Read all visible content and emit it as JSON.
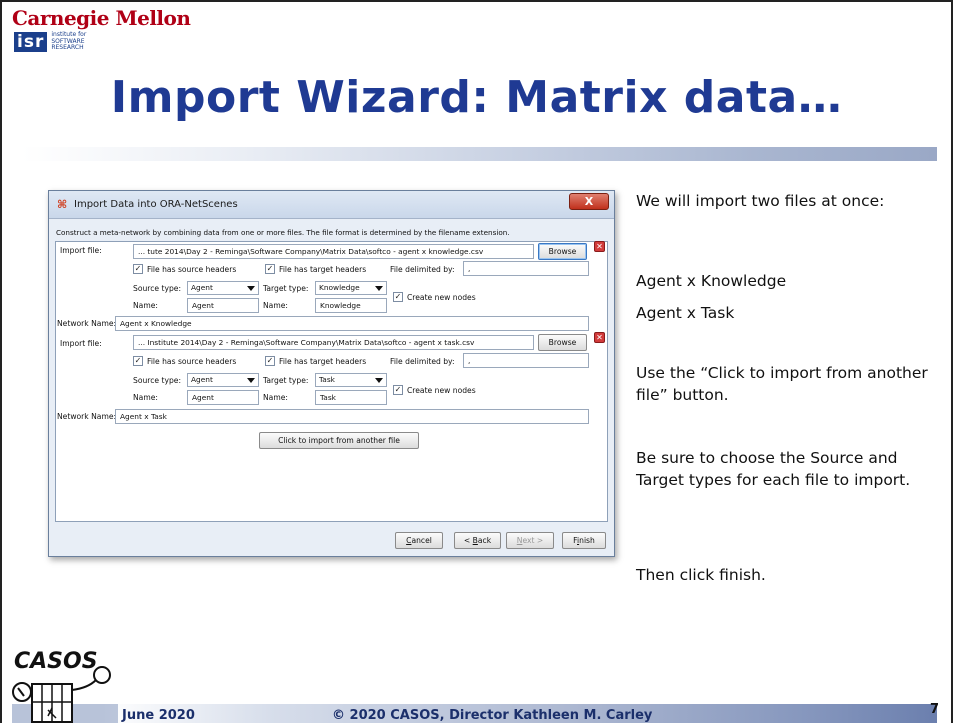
{
  "header": {
    "cmu_logo": "Carnegie Mellon",
    "isr_logo_mark": "isr",
    "isr_logo_text": [
      "institute for",
      "SOFTWARE",
      "RESEARCH"
    ]
  },
  "slide_title": "Import Wizard: Matrix data…",
  "dialog": {
    "title": "Import Data into ORA-NetScenes",
    "close_label": "X",
    "description": "Construct a meta-network by combining data from one or more files. The file format is determined by the filename extension.",
    "entries": [
      {
        "import_file_label": "Import file:",
        "import_file_value": "... tute 2014\\Day 2 - Reminga\\Software Company\\Matrix Data\\softco - agent x knowledge.csv",
        "browse_label": "Browse",
        "source_headers_label": "File has source headers",
        "target_headers_label": "File has target headers",
        "delimited_label": "File delimited by:",
        "delimiter_value": ",",
        "source_type_label": "Source type:",
        "source_type_value": "Agent",
        "target_type_label": "Target type:",
        "target_type_value": "Knowledge",
        "create_nodes_label": "Create new nodes",
        "source_name_label": "Name:",
        "source_name_value": "Agent",
        "target_name_label": "Name:",
        "target_name_value": "Knowledge",
        "network_name_label": "Network Name:",
        "network_name_value": "Agent x Knowledge"
      },
      {
        "import_file_label": "Import file:",
        "import_file_value": "... Institute 2014\\Day 2 - Reminga\\Software Company\\Matrix Data\\softco - agent x task.csv",
        "browse_label": "Browse",
        "source_headers_label": "File has source headers",
        "target_headers_label": "File has target headers",
        "delimited_label": "File delimited by:",
        "delimiter_value": ",",
        "source_type_label": "Source type:",
        "source_type_value": "Agent",
        "target_type_label": "Target type:",
        "target_type_value": "Task",
        "create_nodes_label": "Create new nodes",
        "source_name_label": "Name:",
        "source_name_value": "Agent",
        "target_name_label": "Name:",
        "target_name_value": "Task",
        "network_name_label": "Network Name:",
        "network_name_value": "Agent x Task"
      }
    ],
    "add_file_button": "Click to import from another file",
    "cancel_first": "C",
    "cancel_rest": "ancel",
    "back_prefix": "< ",
    "back_first": "B",
    "back_rest": "ack",
    "next_first": "N",
    "next_rest": "ext >",
    "finish_prefix": "F",
    "finish_first": "i",
    "finish_rest": "nish"
  },
  "notes": {
    "p1": "We will import two files at once:",
    "p2": "Agent x Knowledge",
    "p3": "Agent x Task",
    "p4": "Use the “Click to import from another file” button.",
    "p5": "Be sure to choose the Source and Target types for each file to import.",
    "p6": "Then click finish."
  },
  "footer": {
    "date": "June 2020",
    "copyright": "© 2020 CASOS, Director Kathleen M. Carley",
    "page_number": "7",
    "casos_logo": "CASOS"
  },
  "colors": {
    "title": "#1f3a93",
    "cmu_red": "#b00016",
    "footer_text": "#1b2f6b"
  }
}
